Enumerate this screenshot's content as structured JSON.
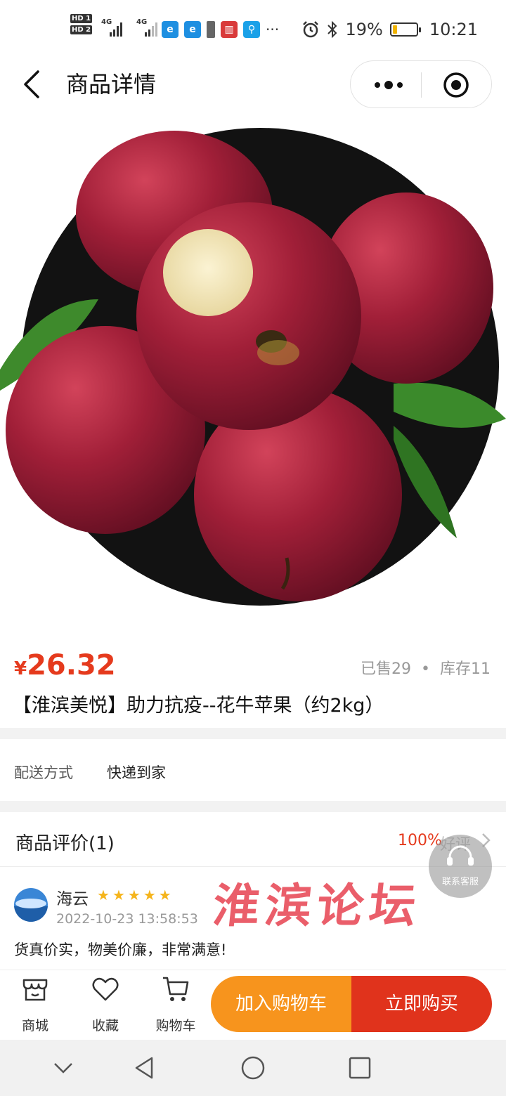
{
  "status_bar": {
    "hd1": "HD 1",
    "hd2": "HD 2",
    "signal1_label": "4G",
    "signal2_label": "4G",
    "more": "···",
    "battery_percent": "19%",
    "battery_level": 0.19,
    "battery_color": "#f0b400",
    "time": "10:21",
    "icons": [
      "alarm-icon",
      "bluetooth-icon"
    ]
  },
  "nav": {
    "title": "商品详情",
    "back_icon": "chevron-left-icon",
    "more_icon": "more-dots-icon",
    "close_icon": "target-icon"
  },
  "product": {
    "image": "red-apples-in-black-bowl",
    "currency": "¥",
    "price": "26.32",
    "sold": "已售29",
    "stock": "库存11",
    "dot": "•",
    "title": "【淮滨美悦】助力抗疫--花牛苹果（约2kg）"
  },
  "delivery": {
    "label": "配送方式",
    "value": "快递到家"
  },
  "reviews": {
    "title": "商品评价(1)",
    "rate": "100%",
    "rate_label": "好评",
    "items": [
      {
        "name": "海云",
        "stars": 5,
        "date": "2022-10-23 13:58:53",
        "text": "货真价实，物美价廉，非常满意!"
      }
    ]
  },
  "watermark": "淮滨论坛",
  "customer_service": {
    "label": "联系客服"
  },
  "action_bar": {
    "tabs": [
      {
        "label": "商城",
        "icon": "shop-icon"
      },
      {
        "label": "收藏",
        "icon": "heart-icon"
      },
      {
        "label": "购物车",
        "icon": "cart-icon"
      }
    ],
    "add_to_cart": "加入购物车",
    "buy_now": "立即购买"
  },
  "colors": {
    "price_red": "#e53a1d",
    "cart_orange": "#f7941d",
    "buy_red": "#e0331c",
    "star_gold": "#f5b41b"
  }
}
